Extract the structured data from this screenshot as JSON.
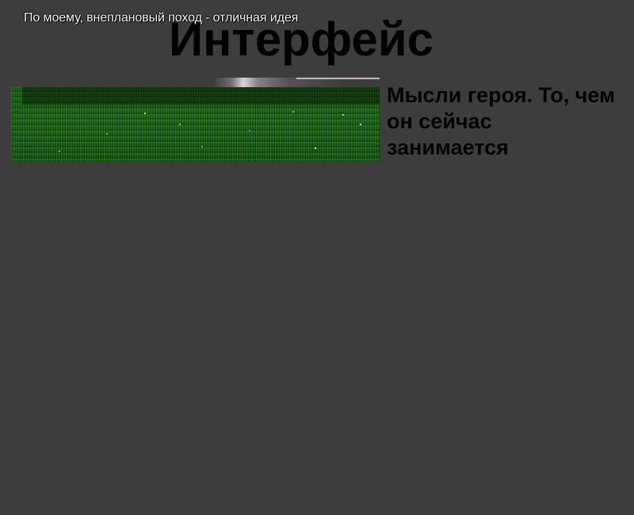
{
  "page": {
    "title": "Интерфейс",
    "background_color": "#3d3d3d"
  },
  "game_view": {
    "hero_thought": "По моему, внеплановый поход - отличная идея",
    "terrain": "grass",
    "grass_color": "#1f6c17"
  },
  "caption": {
    "text": "Мысли героя. То, чем он сейчас занимается"
  }
}
